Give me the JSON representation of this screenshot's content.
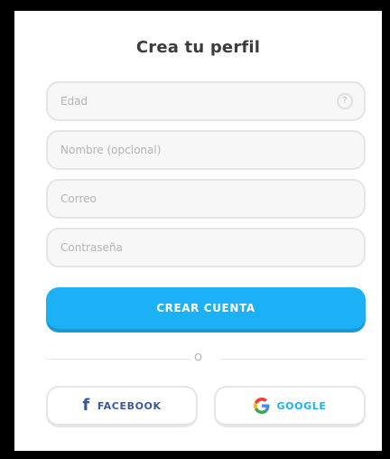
{
  "header": {
    "title": "Crea tu perfil"
  },
  "form": {
    "age": {
      "placeholder": "Edad",
      "value": ""
    },
    "age_help_icon": "?",
    "name": {
      "placeholder": "Nombre (opcional)",
      "value": ""
    },
    "email": {
      "placeholder": "Correo",
      "value": ""
    },
    "password": {
      "placeholder": "Contraseña",
      "value": ""
    },
    "submit_label": "CREAR CUENTA"
  },
  "divider": {
    "label": "O"
  },
  "social": {
    "facebook_label": "FACEBOOK",
    "facebook_icon": "facebook-icon",
    "google_label": "GOOGLE",
    "google_icon": "google-icon"
  },
  "colors": {
    "primary": "#1cb0f6",
    "facebook": "#3b5998",
    "google_text": "#1cb0f6"
  }
}
